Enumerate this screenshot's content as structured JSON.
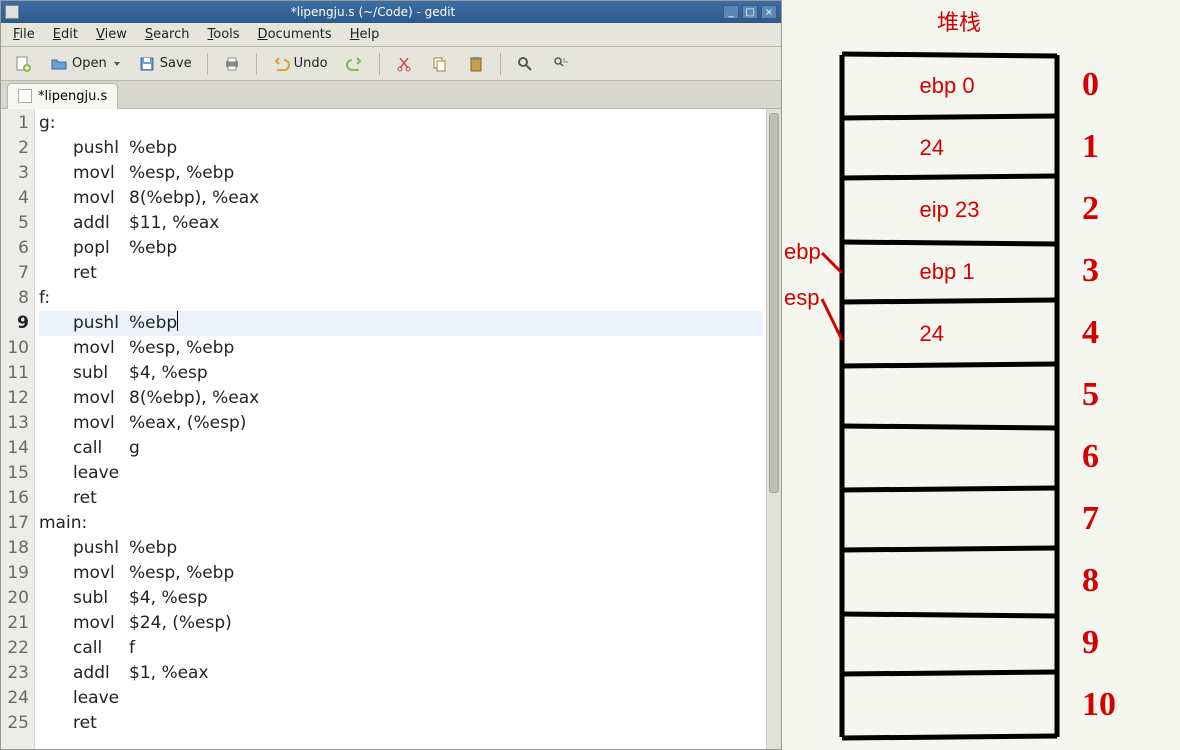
{
  "window": {
    "title": "*lipengju.s (~/Code) - gedit"
  },
  "menus": {
    "file": "File",
    "edit": "Edit",
    "view": "View",
    "search": "Search",
    "tools": "Tools",
    "documents": "Documents",
    "help": "Help"
  },
  "toolbar": {
    "open": "Open",
    "save": "Save",
    "undo": "Undo"
  },
  "tab": {
    "label": "*lipengju.s"
  },
  "cursor_line": 9,
  "code_lines": [
    {
      "n": "1",
      "label": "g:",
      "mn": "",
      "args": ""
    },
    {
      "n": "2",
      "label": "",
      "mn": "pushl",
      "args": "%ebp"
    },
    {
      "n": "3",
      "label": "",
      "mn": "movl",
      "args": "%esp, %ebp"
    },
    {
      "n": "4",
      "label": "",
      "mn": "movl",
      "args": "8(%ebp), %eax"
    },
    {
      "n": "5",
      "label": "",
      "mn": "addl",
      "args": "$11, %eax"
    },
    {
      "n": "6",
      "label": "",
      "mn": "popl",
      "args": "%ebp"
    },
    {
      "n": "7",
      "label": "",
      "mn": "ret",
      "args": ""
    },
    {
      "n": "8",
      "label": "f:",
      "mn": "",
      "args": ""
    },
    {
      "n": "9",
      "label": "",
      "mn": "pushl",
      "args": "%ebp"
    },
    {
      "n": "10",
      "label": "",
      "mn": "movl",
      "args": "%esp, %ebp"
    },
    {
      "n": "11",
      "label": "",
      "mn": "subl",
      "args": "$4, %esp"
    },
    {
      "n": "12",
      "label": "",
      "mn": "movl",
      "args": "8(%ebp), %eax"
    },
    {
      "n": "13",
      "label": "",
      "mn": "movl",
      "args": "%eax, (%esp)"
    },
    {
      "n": "14",
      "label": "",
      "mn": "call",
      "args": "g"
    },
    {
      "n": "15",
      "label": "",
      "mn": "leave",
      "args": ""
    },
    {
      "n": "16",
      "label": "",
      "mn": "ret",
      "args": ""
    },
    {
      "n": "17",
      "label": "main:",
      "mn": "",
      "args": ""
    },
    {
      "n": "18",
      "label": "",
      "mn": "pushl",
      "args": "%ebp"
    },
    {
      "n": "19",
      "label": "",
      "mn": "movl",
      "args": "%esp, %ebp"
    },
    {
      "n": "20",
      "label": "",
      "mn": "subl",
      "args": "$4, %esp"
    },
    {
      "n": "21",
      "label": "",
      "mn": "movl",
      "args": "$24, (%esp)"
    },
    {
      "n": "22",
      "label": "",
      "mn": "call",
      "args": "f"
    },
    {
      "n": "23",
      "label": "",
      "mn": "addl",
      "args": "$1, %eax"
    },
    {
      "n": "24",
      "label": "",
      "mn": "leave",
      "args": ""
    },
    {
      "n": "25",
      "label": "",
      "mn": "ret",
      "args": ""
    }
  ],
  "diagram": {
    "title": "堆栈",
    "ebp_label": "ebp",
    "esp_label": "esp",
    "cells": [
      "ebp 0",
      "24",
      "eip 23",
      "ebp 1",
      "24",
      "",
      "",
      "",
      "",
      "",
      ""
    ],
    "indices": [
      "0",
      "1",
      "2",
      "3",
      "4",
      "5",
      "6",
      "7",
      "8",
      "9",
      "10"
    ],
    "ebp_points_to_index": 3,
    "esp_points_to_index": 4
  }
}
